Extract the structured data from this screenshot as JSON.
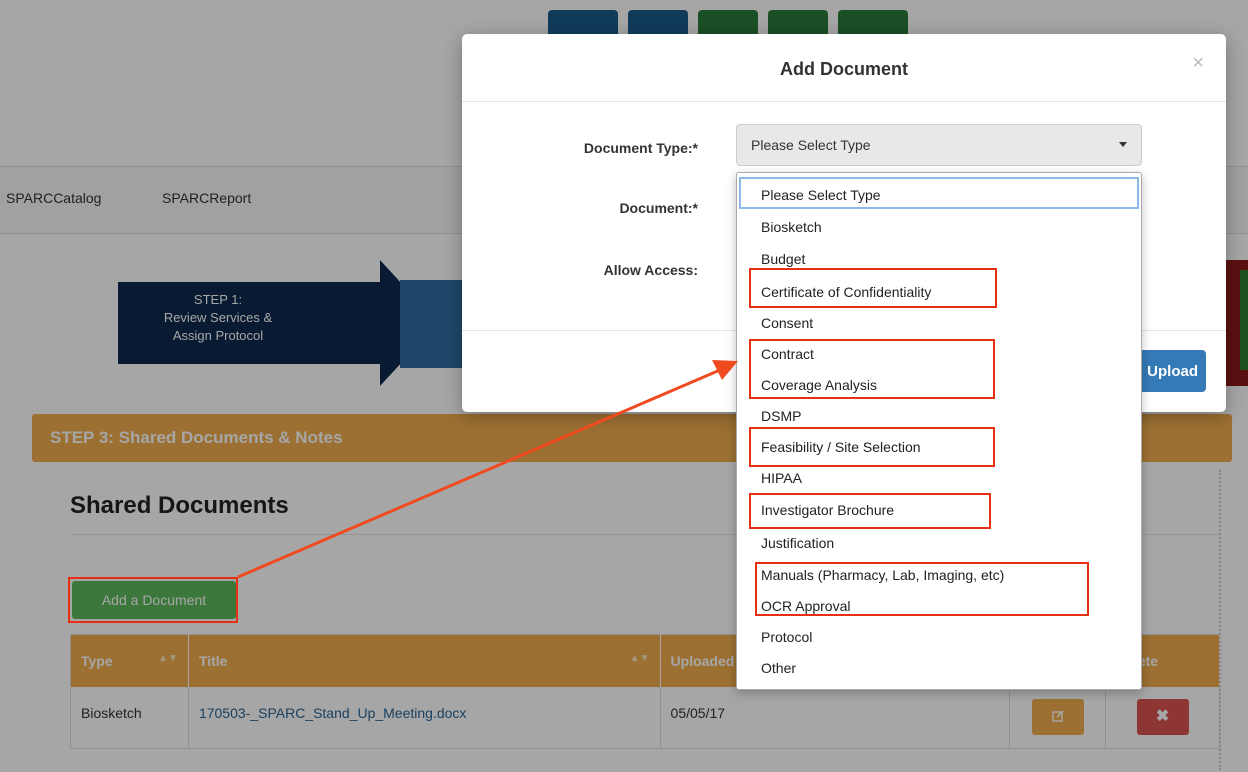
{
  "nav": {
    "items": [
      "SPARCCatalog",
      "SPARCReport"
    ]
  },
  "step1": {
    "line1": "STEP 1:",
    "line2": "Review Services &",
    "line3": "Assign Protocol"
  },
  "step3_bar": "STEP 3: Shared Documents & Notes",
  "shared_documents": {
    "title": "Shared Documents",
    "add_button": "Add a Document",
    "columns": [
      "Type",
      "Title",
      "Uploaded",
      "Delete"
    ],
    "rows": [
      {
        "type": "Biosketch",
        "title": "170503-_SPARC_Stand_Up_Meeting.docx",
        "uploaded": "05/05/17"
      }
    ]
  },
  "modal": {
    "title": "Add Document",
    "close": "×",
    "labels": {
      "document_type": "Document Type:*",
      "document": "Document:*",
      "allow_access": "Allow Access:"
    },
    "select_value": "Please Select Type",
    "upload_button": "Upload"
  },
  "dropdown": {
    "options": [
      "Please Select Type",
      "Biosketch",
      "Budget",
      "Certificate of Confidentiality",
      "Consent",
      "Contract",
      "Coverage Analysis",
      "DSMP",
      "Feasibility / Site Selection",
      "HIPAA",
      "Investigator Brochure",
      "Justification",
      "Manuals (Pharmacy, Lab, Imaging, etc)",
      "OCR Approval",
      "Protocol",
      "Other"
    ]
  },
  "colors": {
    "orange": "#f0ad4e",
    "green": "#5cb85c",
    "blue": "#337ab7",
    "navy": "#0d2a4d",
    "annotation_red": "#e53012"
  },
  "icons": {
    "edit": "pencil-icon",
    "delete": "x-icon",
    "close": "close-icon",
    "caret": "chevron-down-icon",
    "sort": "sort-icon"
  }
}
